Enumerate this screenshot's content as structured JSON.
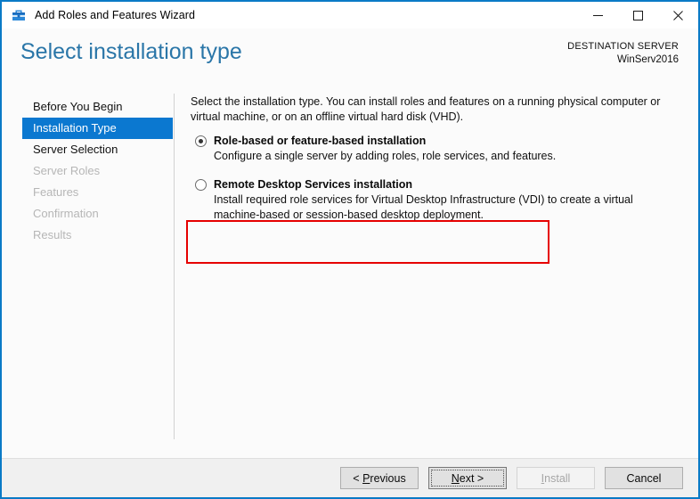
{
  "window": {
    "title": "Add Roles and Features Wizard",
    "icon": "roles-features-icon",
    "accent_color": "#0a7ac6",
    "controls": {
      "minimize": "—",
      "maximize": "□",
      "close": "✕"
    }
  },
  "header": {
    "page_title": "Select installation type",
    "destination_label": "DESTINATION SERVER",
    "destination_value": "WinServ2016",
    "title_color": "#2a76a8"
  },
  "sidebar": {
    "items": [
      {
        "label": "Before You Begin",
        "state": "enabled"
      },
      {
        "label": "Installation Type",
        "state": "selected"
      },
      {
        "label": "Server Selection",
        "state": "enabled"
      },
      {
        "label": "Server Roles",
        "state": "disabled"
      },
      {
        "label": "Features",
        "state": "disabled"
      },
      {
        "label": "Confirmation",
        "state": "disabled"
      },
      {
        "label": "Results",
        "state": "disabled"
      }
    ],
    "selected_color": "#0b78d0"
  },
  "main": {
    "intro": "Select the installation type. You can install roles and features on a running physical computer or virtual machine, or on an offline virtual hard disk (VHD).",
    "options": [
      {
        "title": "Role-based or feature-based installation",
        "description": "Configure a single server by adding roles, role services, and features.",
        "selected": true
      },
      {
        "title": "Remote Desktop Services installation",
        "description": "Install required role services for Virtual Desktop Infrastructure (VDI) to create a virtual machine-based or session-based desktop deployment.",
        "selected": false
      }
    ],
    "highlight_color": "#e60000"
  },
  "footer": {
    "buttons": [
      {
        "label": "< Previous",
        "accel": "P",
        "state": "normal"
      },
      {
        "label": "Next >",
        "accel": "N",
        "state": "default-focused"
      },
      {
        "label": "Install",
        "accel": "I",
        "state": "disabled"
      },
      {
        "label": "Cancel",
        "accel": "",
        "state": "normal"
      }
    ]
  }
}
